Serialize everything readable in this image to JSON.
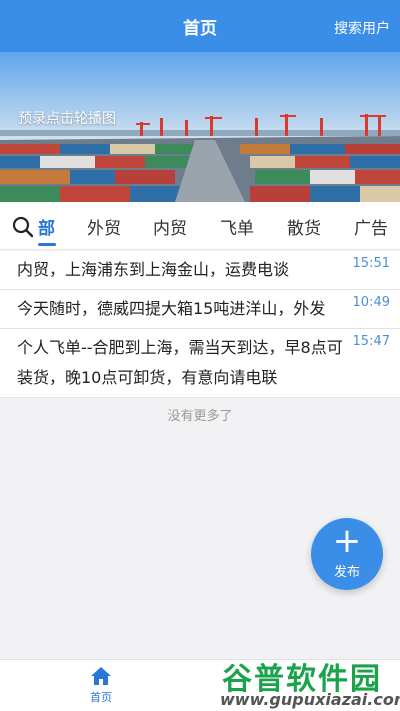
{
  "header": {
    "title": "首页",
    "search_users": "搜索用户"
  },
  "banner": {
    "caption": "预录点击轮播图"
  },
  "tabs": [
    {
      "label": "部",
      "active": true
    },
    {
      "label": "外贸"
    },
    {
      "label": "内贸"
    },
    {
      "label": "飞单"
    },
    {
      "label": "散货"
    },
    {
      "label": "广告"
    }
  ],
  "posts": [
    {
      "text": "内贸，上海浦东到上海金山，运费电谈",
      "time": "15:51"
    },
    {
      "text": "今天随时，德威四提大箱15吨进洋山，外发",
      "time": "10:49"
    },
    {
      "text": "个人飞单--合肥到上海，需当天到达，早8点可装货，晚10点可卸货，有意向请电联",
      "time": "15:47"
    }
  ],
  "no_more": "没有更多了",
  "fab": {
    "label": "发布"
  },
  "bottom_nav": {
    "home_label": "首页"
  },
  "watermark": {
    "logo": "谷普软件园",
    "url": "www.gupuxiazai.com"
  },
  "colors": {
    "primary": "#3b8ee8",
    "accent": "#2a77d8",
    "time": "#4b8fd8"
  }
}
